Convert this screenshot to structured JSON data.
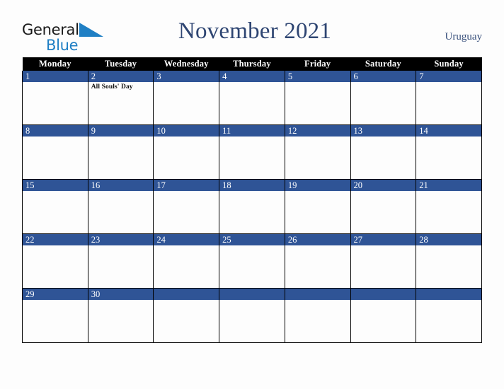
{
  "brand": {
    "line1": "General",
    "line2": "Blue",
    "icon": "triangle-logo-icon",
    "color_dark": "#1a1a1a",
    "color_blue": "#1f7fc4"
  },
  "header": {
    "title": "November 2021",
    "country": "Uruguay",
    "title_color": "#2e4572"
  },
  "calendar": {
    "weekday_headers": [
      "Monday",
      "Tuesday",
      "Wednesday",
      "Thursday",
      "Friday",
      "Saturday",
      "Sunday"
    ],
    "header_bg": "#000000",
    "daynum_bg": "#2f5496",
    "cell_bg": "#fdfdfd",
    "weeks": [
      [
        {
          "day": "1",
          "events": []
        },
        {
          "day": "2",
          "events": [
            "All Souls' Day"
          ]
        },
        {
          "day": "3",
          "events": []
        },
        {
          "day": "4",
          "events": []
        },
        {
          "day": "5",
          "events": []
        },
        {
          "day": "6",
          "events": []
        },
        {
          "day": "7",
          "events": []
        }
      ],
      [
        {
          "day": "8",
          "events": []
        },
        {
          "day": "9",
          "events": []
        },
        {
          "day": "10",
          "events": []
        },
        {
          "day": "11",
          "events": []
        },
        {
          "day": "12",
          "events": []
        },
        {
          "day": "13",
          "events": []
        },
        {
          "day": "14",
          "events": []
        }
      ],
      [
        {
          "day": "15",
          "events": []
        },
        {
          "day": "16",
          "events": []
        },
        {
          "day": "17",
          "events": []
        },
        {
          "day": "18",
          "events": []
        },
        {
          "day": "19",
          "events": []
        },
        {
          "day": "20",
          "events": []
        },
        {
          "day": "21",
          "events": []
        }
      ],
      [
        {
          "day": "22",
          "events": []
        },
        {
          "day": "23",
          "events": []
        },
        {
          "day": "24",
          "events": []
        },
        {
          "day": "25",
          "events": []
        },
        {
          "day": "26",
          "events": []
        },
        {
          "day": "27",
          "events": []
        },
        {
          "day": "28",
          "events": []
        }
      ],
      [
        {
          "day": "29",
          "events": []
        },
        {
          "day": "30",
          "events": []
        },
        {
          "day": "",
          "events": []
        },
        {
          "day": "",
          "events": []
        },
        {
          "day": "",
          "events": []
        },
        {
          "day": "",
          "events": []
        },
        {
          "day": "",
          "events": []
        }
      ]
    ]
  }
}
